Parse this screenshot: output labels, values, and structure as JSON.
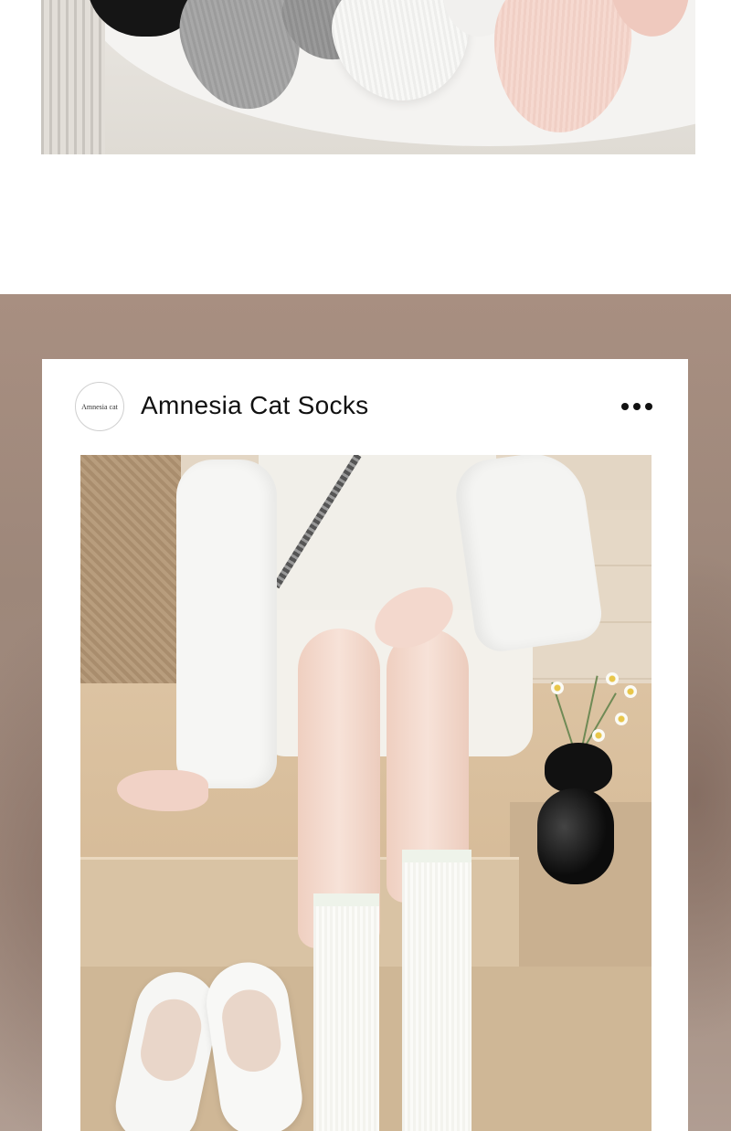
{
  "post": {
    "avatar_text": "Amnesia cat",
    "account_name": "Amnesia Cat Socks",
    "more_icon": "more-horizontal-icon"
  },
  "colors": {
    "page_background": "#ffffff",
    "blurred_background": "#a38d80",
    "card_background": "#ffffff",
    "text": "#111111"
  }
}
